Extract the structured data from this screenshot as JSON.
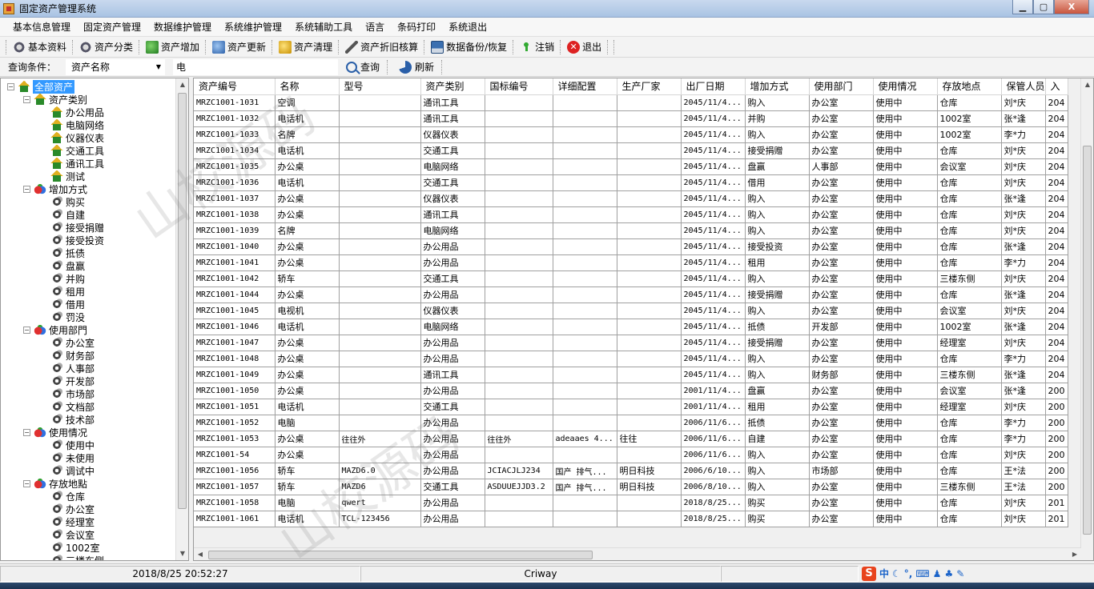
{
  "window": {
    "title": "固定资产管理系统",
    "min_label": "▁",
    "max_label": "▢",
    "close_label": "X"
  },
  "menu": [
    "基本信息管理",
    "固定资产管理",
    "数据维护管理",
    "系统维护管理",
    "系统辅助工具",
    "语言",
    "条码打印",
    "系统退出"
  ],
  "toolbar": [
    {
      "label": "基本资料",
      "icon": "gear-icon"
    },
    {
      "label": "资产分类",
      "icon": "gear-icon"
    },
    {
      "label": "资产增加",
      "icon": "add-icon"
    },
    {
      "label": "资产更新",
      "icon": "update-icon"
    },
    {
      "label": "资产清理",
      "icon": "clean-icon"
    },
    {
      "label": "资产折旧核算",
      "icon": "pen-icon"
    },
    {
      "label": "数据备份/恢复",
      "icon": "disk-icon"
    },
    {
      "label": "注销",
      "icon": "logout-icon"
    },
    {
      "label": "退出",
      "icon": "exit-icon"
    }
  ],
  "query": {
    "label": "查询条件：",
    "field": "资产名称",
    "value": "电",
    "search_label": "查询",
    "refresh_label": "刷新"
  },
  "tree": {
    "root": "全部资产",
    "groups": [
      {
        "label": "资产类别",
        "icon": "house-icon",
        "items": [
          "办公用品",
          "电脑网络",
          "仪器仪表",
          "交通工具",
          "通讯工具",
          "测试"
        ]
      },
      {
        "label": "增加方式",
        "icon": "fruit-icon",
        "items": [
          "购买",
          "自建",
          "接受捐赠",
          "接受投资",
          "抵债",
          "盘赢",
          "并购",
          "租用",
          "借用",
          "罚没"
        ]
      },
      {
        "label": "使用部門",
        "icon": "fruit-icon",
        "items": [
          "办公室",
          "财务部",
          "人事部",
          "开发部",
          "市场部",
          "文档部",
          "技术部"
        ]
      },
      {
        "label": "使用情况",
        "icon": "fruit-icon",
        "items": [
          "使用中",
          "未使用",
          "调试中"
        ]
      },
      {
        "label": "存放地點",
        "icon": "fruit-icon",
        "items": [
          "仓库",
          "办公室",
          "经理室",
          "会议室",
          "1002室",
          "三楼东侧"
        ]
      }
    ]
  },
  "grid": {
    "columns": [
      "资产编号",
      "名称",
      "型号",
      "资产类别",
      "国标编号",
      "详细配置",
      "生产厂家",
      "出厂日期",
      "增加方式",
      "使用部门",
      "使用情况",
      "存放地点",
      "保管人员",
      "入"
    ],
    "rows": [
      [
        "MRZC1001-1031",
        "空调",
        "",
        "通讯工具",
        "",
        "",
        "",
        "2045/11/4...",
        "购入",
        "办公室",
        "使用中",
        "仓库",
        "刘*庆",
        "204"
      ],
      [
        "MRZC1001-1032",
        "电话机",
        "",
        "通讯工具",
        "",
        "",
        "",
        "2045/11/4...",
        "并购",
        "办公室",
        "使用中",
        "1002室",
        "张*逢",
        "204"
      ],
      [
        "MRZC1001-1033",
        "名牌",
        "",
        "仪器仪表",
        "",
        "",
        "",
        "2045/11/4...",
        "购入",
        "办公室",
        "使用中",
        "1002室",
        "李*力",
        "204"
      ],
      [
        "MRZC1001-1034",
        "电话机",
        "",
        "交通工具",
        "",
        "",
        "",
        "2045/11/4...",
        "接受捐赠",
        "办公室",
        "使用中",
        "仓库",
        "刘*庆",
        "204"
      ],
      [
        "MRZC1001-1035",
        "办公桌",
        "",
        "电脑网络",
        "",
        "",
        "",
        "2045/11/4...",
        "盘赢",
        "人事部",
        "使用中",
        "会议室",
        "刘*庆",
        "204"
      ],
      [
        "MRZC1001-1036",
        "电话机",
        "",
        "交通工具",
        "",
        "",
        "",
        "2045/11/4...",
        "借用",
        "办公室",
        "使用中",
        "仓库",
        "刘*庆",
        "204"
      ],
      [
        "MRZC1001-1037",
        "办公桌",
        "",
        "仪器仪表",
        "",
        "",
        "",
        "2045/11/4...",
        "购入",
        "办公室",
        "使用中",
        "仓库",
        "张*逢",
        "204"
      ],
      [
        "MRZC1001-1038",
        "办公桌",
        "",
        "通讯工具",
        "",
        "",
        "",
        "2045/11/4...",
        "购入",
        "办公室",
        "使用中",
        "仓库",
        "刘*庆",
        "204"
      ],
      [
        "MRZC1001-1039",
        "名牌",
        "",
        "电脑网络",
        "",
        "",
        "",
        "2045/11/4...",
        "购入",
        "办公室",
        "使用中",
        "仓库",
        "刘*庆",
        "204"
      ],
      [
        "MRZC1001-1040",
        "办公桌",
        "",
        "办公用品",
        "",
        "",
        "",
        "2045/11/4...",
        "接受投资",
        "办公室",
        "使用中",
        "仓库",
        "张*逢",
        "204"
      ],
      [
        "MRZC1001-1041",
        "办公桌",
        "",
        "办公用品",
        "",
        "",
        "",
        "2045/11/4...",
        "租用",
        "办公室",
        "使用中",
        "仓库",
        "李*力",
        "204"
      ],
      [
        "MRZC1001-1042",
        "轿车",
        "",
        "交通工具",
        "",
        "",
        "",
        "2045/11/4...",
        "购入",
        "办公室",
        "使用中",
        "三楼东侧",
        "刘*庆",
        "204"
      ],
      [
        "MRZC1001-1044",
        "办公桌",
        "",
        "办公用品",
        "",
        "",
        "",
        "2045/11/4...",
        "接受捐赠",
        "办公室",
        "使用中",
        "仓库",
        "张*逢",
        "204"
      ],
      [
        "MRZC1001-1045",
        "电视机",
        "",
        "仪器仪表",
        "",
        "",
        "",
        "2045/11/4...",
        "购入",
        "办公室",
        "使用中",
        "会议室",
        "刘*庆",
        "204"
      ],
      [
        "MRZC1001-1046",
        "电话机",
        "",
        "电脑网络",
        "",
        "",
        "",
        "2045/11/4...",
        "抵债",
        "开发部",
        "使用中",
        "1002室",
        "张*逢",
        "204"
      ],
      [
        "MRZC1001-1047",
        "办公桌",
        "",
        "办公用品",
        "",
        "",
        "",
        "2045/11/4...",
        "接受捐赠",
        "办公室",
        "使用中",
        "经理室",
        "刘*庆",
        "204"
      ],
      [
        "MRZC1001-1048",
        "办公桌",
        "",
        "办公用品",
        "",
        "",
        "",
        "2045/11/4...",
        "购入",
        "办公室",
        "使用中",
        "仓库",
        "李*力",
        "204"
      ],
      [
        "MRZC1001-1049",
        "办公桌",
        "",
        "通讯工具",
        "",
        "",
        "",
        "2045/11/4...",
        "购入",
        "财务部",
        "使用中",
        "三楼东侧",
        "张*逢",
        "204"
      ],
      [
        "MRZC1001-1050",
        "办公桌",
        "",
        "办公用品",
        "",
        "",
        "",
        "2001/11/4...",
        "盘赢",
        "办公室",
        "使用中",
        "会议室",
        "张*逢",
        "200"
      ],
      [
        "MRZC1001-1051",
        "电话机",
        "",
        "交通工具",
        "",
        "",
        "",
        "2001/11/4...",
        "租用",
        "办公室",
        "使用中",
        "经理室",
        "刘*庆",
        "200"
      ],
      [
        "MRZC1001-1052",
        "电脑",
        "",
        "办公用品",
        "",
        "",
        "",
        "2006/11/6...",
        "抵债",
        "办公室",
        "使用中",
        "仓库",
        "李*力",
        "200"
      ],
      [
        "MRZC1001-1053",
        "办公桌",
        "往往外",
        "办公用品",
        "往往外",
        "adeaaes 4...",
        "往往",
        "2006/11/6...",
        "自建",
        "办公室",
        "使用中",
        "仓库",
        "李*力",
        "200"
      ],
      [
        "MRZC1001-54",
        "办公桌",
        "",
        "办公用品",
        "",
        "",
        "",
        "2006/11/6...",
        "购入",
        "办公室",
        "使用中",
        "仓库",
        "刘*庆",
        "200"
      ],
      [
        "MRZC1001-1056",
        "轿车",
        "MAZD6.0",
        "办公用品",
        "JCIACJLJ234",
        "国产 排气...",
        "明日科技",
        "2006/6/10...",
        "购入",
        "市场部",
        "使用中",
        "仓库",
        "王*法",
        "200"
      ],
      [
        "MRZC1001-1057",
        "轿车",
        "MAZD6",
        "交通工具",
        "ASDUUEJJD3.2",
        "国产 排气...",
        "明日科技",
        "2006/8/10...",
        "购入",
        "办公室",
        "使用中",
        "三楼东侧",
        "王*法",
        "200"
      ],
      [
        "MRZC1001-1058",
        "电脑",
        "qwert",
        "办公用品",
        "",
        "",
        "",
        "2018/8/25...",
        "购买",
        "办公室",
        "使用中",
        "仓库",
        "刘*庆",
        "201"
      ],
      [
        "MRZC1001-1061",
        "电话机",
        "TCL-123456",
        "办公用品",
        "",
        "",
        "",
        "2018/8/25...",
        "购买",
        "办公室",
        "使用中",
        "仓库",
        "刘*庆",
        "201"
      ]
    ]
  },
  "status": {
    "datetime": "2018/8/25 20:52:27",
    "company": "Criway",
    "ime_zh": "中"
  },
  "watermarks": [
    "山校源码",
    "山校源码"
  ]
}
